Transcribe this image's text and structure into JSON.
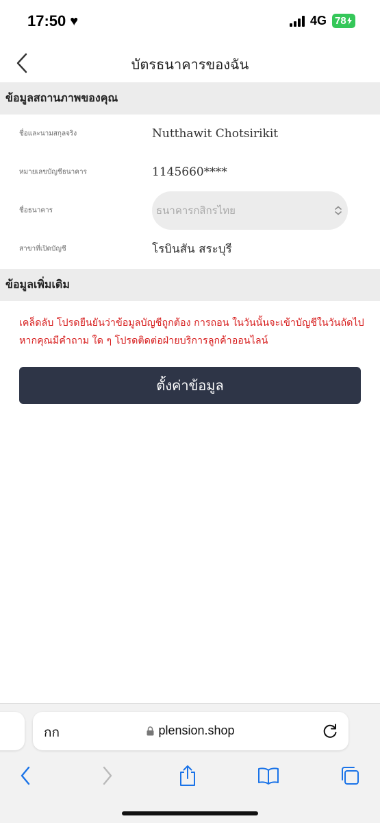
{
  "status_bar": {
    "time": "17:50",
    "network": "4G",
    "battery": "78"
  },
  "header": {
    "title": "บัตรธนาคารของฉัน"
  },
  "section_status": {
    "title": "ข้อมูลสถานภาพของคุณ"
  },
  "fields": {
    "name": {
      "label": "ชื่อและนามสกุลจริง",
      "value": "Nutthawit Chotsirikit"
    },
    "account": {
      "label": "หมายเลขบัญชีธนาคาร",
      "value": "1145660****"
    },
    "bank": {
      "label": "ชื่อธนาคาร",
      "value": "ธนาคารกสิกรไทย"
    },
    "branch": {
      "label": "สาขาที่เปิดบัญชี",
      "value": "โรบินสัน สระบุรี"
    }
  },
  "section_more": {
    "title": "ข้อมูลเพิ่มเติม"
  },
  "note": "เคล็ดลับ โปรดยืนยันว่าข้อมูลบัญชีถูกต้อง การถอน ในวันนั้นจะเข้าบัญชีในวันถัดไป หากคุณมีคำถาม ใด ๆ โปรดติดต่อฝ่ายบริการลูกค้าออนไลน์",
  "submit": {
    "label": "ตั้งค่าข้อมูล"
  },
  "browser": {
    "text_size": "กก",
    "url": "plension.shop"
  },
  "colors": {
    "accent_button": "#2e3547",
    "note_red": "#d61a1a",
    "section_bg": "#ececec",
    "battery_green": "#35c759",
    "link_blue": "#1a73e8"
  }
}
